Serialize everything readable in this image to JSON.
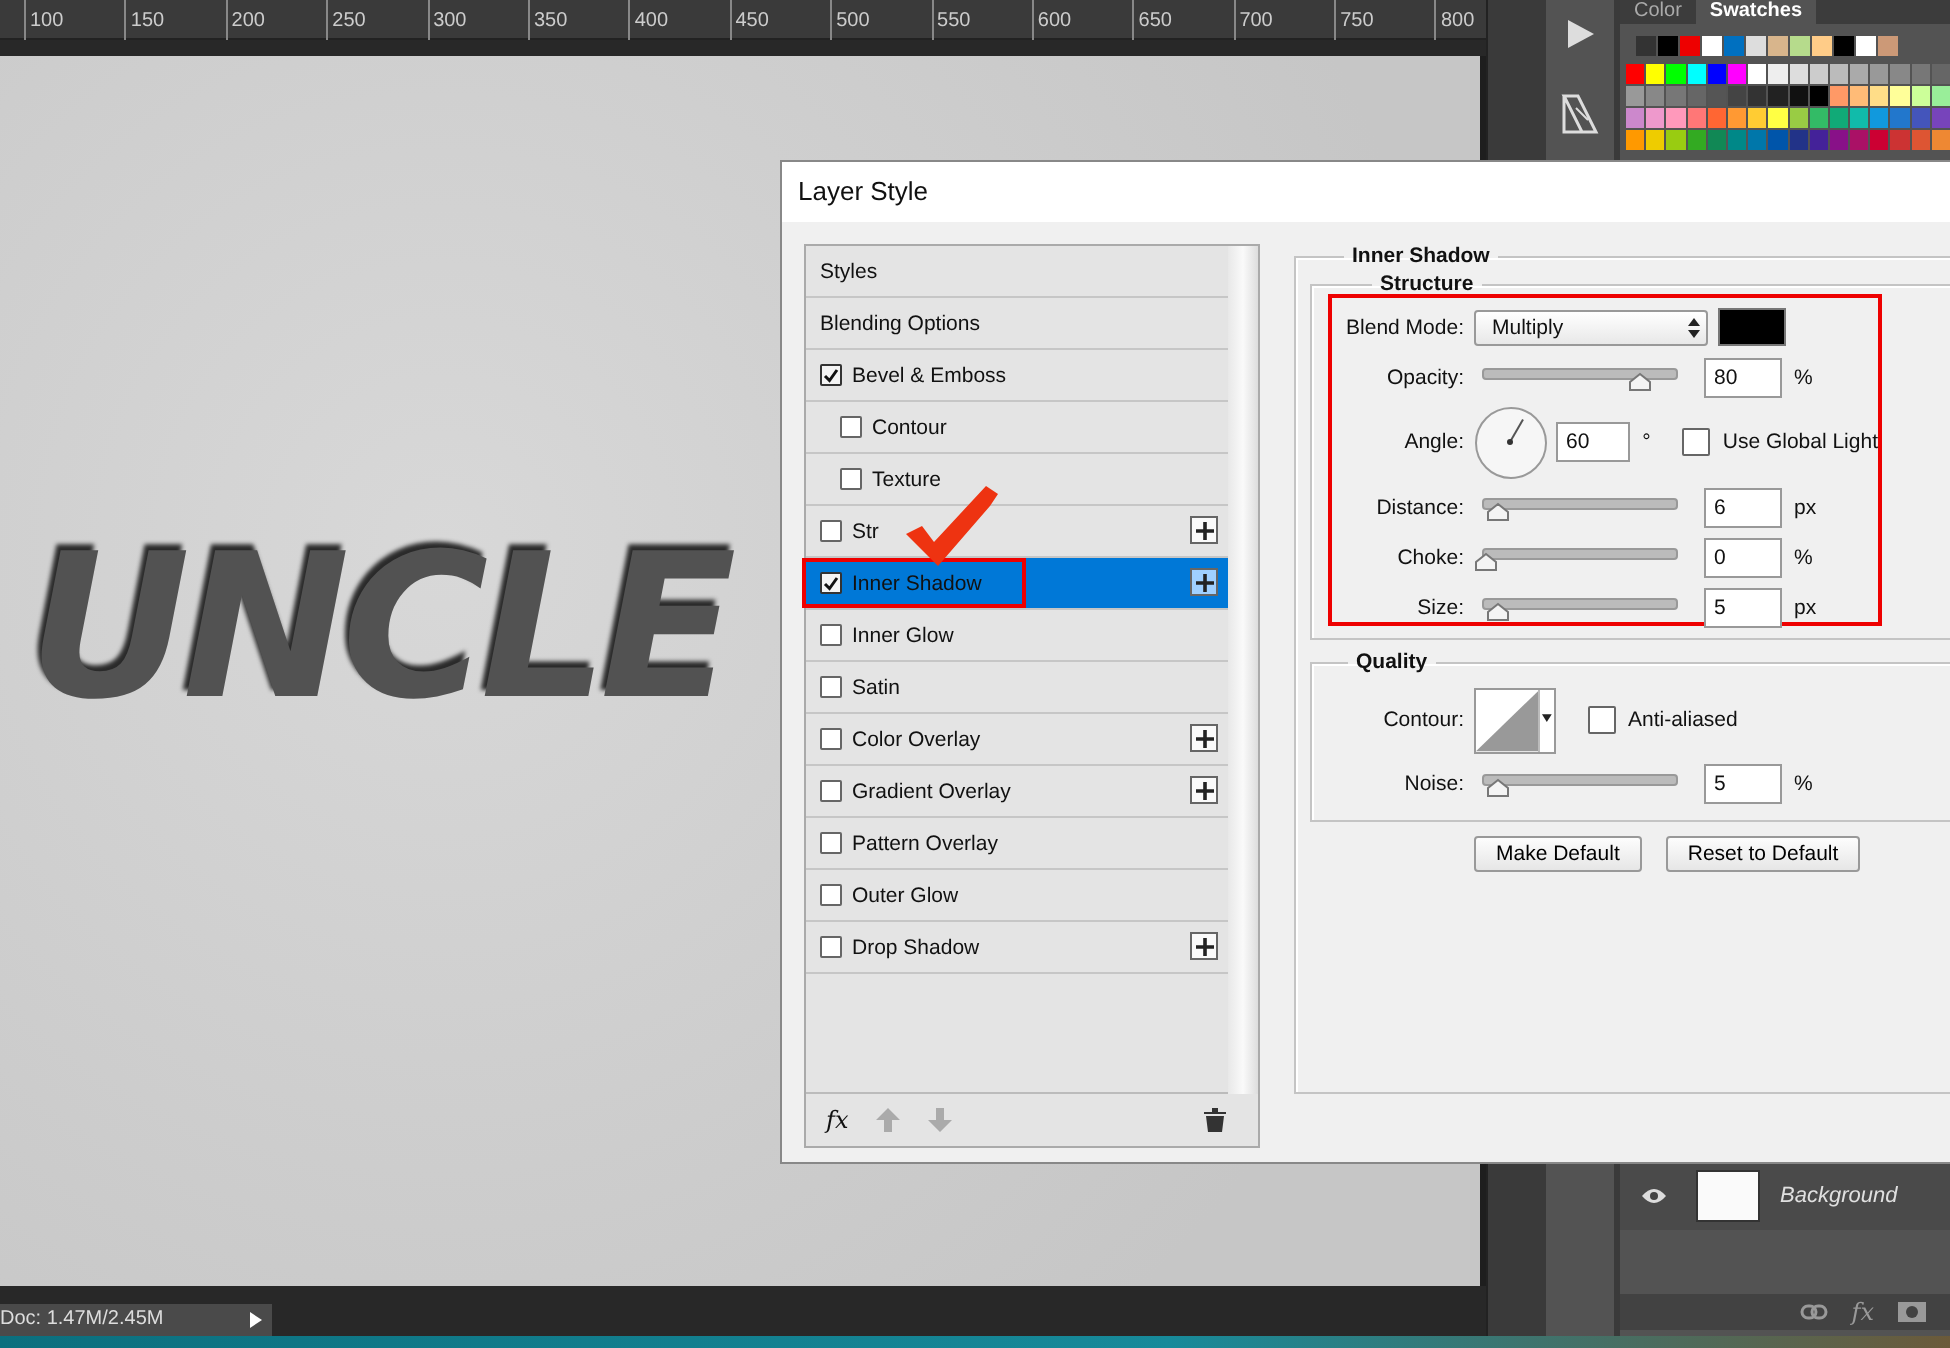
{
  "ruler": {
    "labels": [
      "100",
      "150",
      "200",
      "250",
      "300",
      "350",
      "400",
      "450",
      "500",
      "550",
      "600",
      "650",
      "700",
      "750",
      "800"
    ]
  },
  "canvas": {
    "text": "UNCLE"
  },
  "swatches_panel": {
    "tabs": [
      {
        "label": "Color",
        "selected": false
      },
      {
        "label": "Swatches",
        "selected": true
      }
    ]
  },
  "layers": [
    {
      "name": "Background",
      "visible": true
    }
  ],
  "layers_toolbar": {
    "fx": "fx"
  },
  "status_bar": {
    "doc": "Doc: 1.47M/2.45M"
  },
  "dialog": {
    "title": "Layer Style",
    "fx": "fx",
    "styles": [
      {
        "label": "Styles",
        "kind": "header",
        "selected": false,
        "addable": false,
        "highlighted": false
      },
      {
        "label": "Blending Options",
        "kind": "header",
        "selected": false,
        "addable": false,
        "highlighted": false
      },
      {
        "label": "Bevel & Emboss",
        "kind": "effect",
        "checked": true,
        "selected": false,
        "addable": false,
        "highlighted": false
      },
      {
        "label": "Contour",
        "kind": "sub",
        "checked": false,
        "selected": false,
        "addable": false,
        "highlighted": false
      },
      {
        "label": "Texture",
        "kind": "sub",
        "checked": false,
        "selected": false,
        "addable": false,
        "highlighted": false
      },
      {
        "label": "Str",
        "kind": "effect",
        "checked": false,
        "selected": false,
        "addable": true,
        "highlighted": false
      },
      {
        "label": "Inner Shadow",
        "kind": "effect",
        "checked": true,
        "selected": true,
        "addable": true,
        "highlighted": true
      },
      {
        "label": "Inner Glow",
        "kind": "effect",
        "checked": false,
        "selected": false,
        "addable": false,
        "highlighted": false
      },
      {
        "label": "Satin",
        "kind": "effect",
        "checked": false,
        "selected": false,
        "addable": false,
        "highlighted": false
      },
      {
        "label": "Color Overlay",
        "kind": "effect",
        "checked": false,
        "selected": false,
        "addable": true,
        "highlighted": false
      },
      {
        "label": "Gradient Overlay",
        "kind": "effect",
        "checked": false,
        "selected": false,
        "addable": true,
        "highlighted": false
      },
      {
        "label": "Pattern Overlay",
        "kind": "effect",
        "checked": false,
        "selected": false,
        "addable": false,
        "highlighted": false
      },
      {
        "label": "Outer Glow",
        "kind": "effect",
        "checked": false,
        "selected": false,
        "addable": false,
        "highlighted": false
      },
      {
        "label": "Drop Shadow",
        "kind": "effect",
        "checked": false,
        "selected": false,
        "addable": true,
        "highlighted": false
      }
    ],
    "inner_shadow": {
      "title": "Inner Shadow",
      "structure": {
        "title": "Structure",
        "highlighted": true,
        "blend_mode": {
          "label": "Blend Mode:",
          "value": "Multiply"
        },
        "opacity": {
          "label": "Opacity:",
          "value": "80",
          "unit": "%",
          "level": 0.8
        },
        "angle": {
          "label": "Angle:",
          "value": "60",
          "unit": "°"
        },
        "use_global_light": {
          "label": "Use Global Light",
          "checked": false
        },
        "distance": {
          "label": "Distance:",
          "value": "6",
          "unit": "px",
          "level": 0.06
        },
        "choke": {
          "label": "Choke:",
          "value": "0",
          "unit": "%",
          "level": 0
        },
        "size": {
          "label": "Size:",
          "value": "5",
          "unit": "px",
          "level": 0.06
        }
      },
      "quality": {
        "title": "Quality",
        "contour": {
          "label": "Contour:"
        },
        "anti_aliased": {
          "label": "Anti-aliased",
          "checked": false
        },
        "noise": {
          "label": "Noise:",
          "value": "5",
          "unit": "%",
          "level": 0.06
        }
      },
      "buttons": [
        "Make Default",
        "Reset to Default"
      ]
    }
  }
}
